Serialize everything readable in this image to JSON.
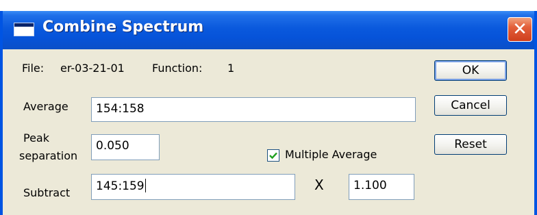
{
  "window": {
    "title": "Combine Spectrum",
    "close_glyph": "✕"
  },
  "info": {
    "file_label": "File:",
    "file_value": "er-03-21-01",
    "function_label": "Function:",
    "function_value": "1"
  },
  "fields": {
    "average_label": "Average",
    "average_value": "154:158",
    "peak_label_line1": "Peak",
    "peak_label_line2": "separation",
    "peak_value": "0.050",
    "multiple_average_label": "Multiple Average",
    "multiple_average_checked": true,
    "subtract_label": "Subtract",
    "subtract_value": "145:159",
    "times_symbol": "X",
    "factor_value": "1.100"
  },
  "buttons": {
    "ok": "OK",
    "cancel": "Cancel",
    "reset": "Reset"
  },
  "icons": {
    "title_icon": "window-icon",
    "close_icon": "close-icon",
    "checkbox_icon": "checkmark-icon"
  }
}
